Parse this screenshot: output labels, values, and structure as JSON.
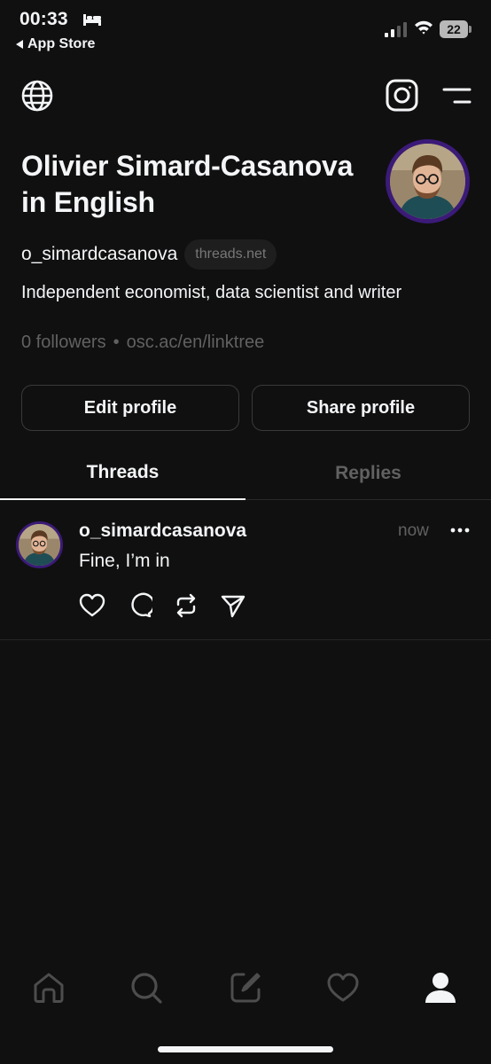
{
  "status_bar": {
    "time": "00:33",
    "back_app": "App Store",
    "battery": "22"
  },
  "profile": {
    "name": "Olivier Simard-Casanova in English",
    "handle": "o_simardcasanova",
    "domain_badge": "threads.net",
    "bio": "Independent economist, data scientist and writer",
    "followers": "0 followers",
    "separator": "•",
    "link": "osc.ac/en/linktree"
  },
  "buttons": {
    "edit": "Edit profile",
    "share": "Share profile"
  },
  "tabs": [
    {
      "label": "Threads",
      "active": true
    },
    {
      "label": "Replies",
      "active": false
    }
  ],
  "post": {
    "username": "o_simardcasanova",
    "time": "now",
    "text": "Fine, I’m in"
  },
  "icons": {
    "top_left": "globe-icon",
    "top_right": [
      "instagram-icon",
      "menu-icon"
    ],
    "post_actions": [
      "like-icon",
      "reply-icon",
      "repost-icon",
      "send-icon"
    ],
    "bottom_nav": [
      "home-icon",
      "search-icon",
      "compose-icon",
      "activity-icon",
      "profile-icon"
    ]
  },
  "colors": {
    "background": "#101010",
    "text": "#f3f5f7",
    "muted": "#616161",
    "avatar_ring": "#3b1a78"
  }
}
